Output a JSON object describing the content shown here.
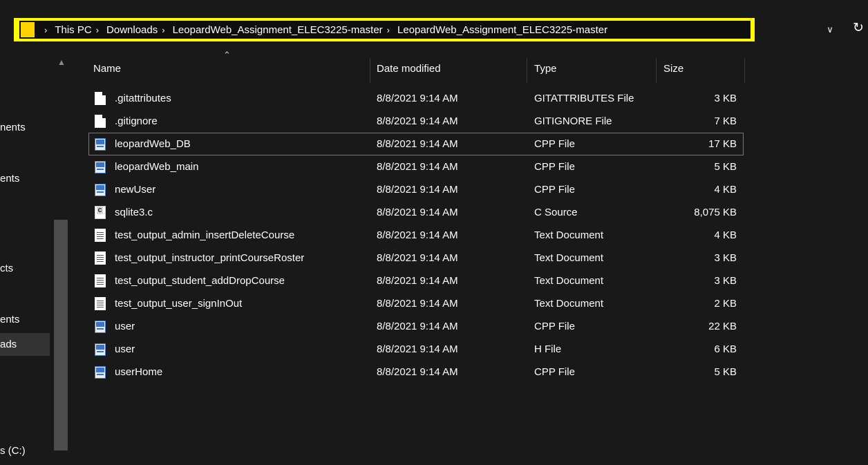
{
  "address_bar": {
    "breadcrumbs": [
      "This PC",
      "Downloads",
      "LeopardWeb_Assignment_ELEC3225-master",
      "LeopardWeb_Assignment_ELEC3225-master"
    ],
    "separator": "›",
    "highlight_color": "#fffb00",
    "folder_icon": "folder-icon",
    "dropdown_icon": "chevron-down-icon",
    "refresh_icon": "refresh-icon"
  },
  "nav_pane": {
    "items": [
      {
        "label": "nents"
      },
      {
        "label": "ents"
      },
      {
        "label": "cts"
      },
      {
        "label": "ents"
      },
      {
        "label": "ads",
        "selected": true
      },
      {
        "label": "s (C:)"
      }
    ]
  },
  "columns": {
    "name": "Name",
    "date": "Date modified",
    "type": "Type",
    "size": "Size"
  },
  "files": [
    {
      "name": ".gitattributes",
      "date": "8/8/2021 9:14 AM",
      "type": "GITATTRIBUTES File",
      "size": "3 KB",
      "icon": "generic-file-icon"
    },
    {
      "name": ".gitignore",
      "date": "8/8/2021 9:14 AM",
      "type": "GITIGNORE File",
      "size": "7 KB",
      "icon": "generic-file-icon"
    },
    {
      "name": "leopardWeb_DB",
      "date": "8/8/2021 9:14 AM",
      "type": "CPP File",
      "size": "17 KB",
      "icon": "cpp-file-icon",
      "selected": true
    },
    {
      "name": "leopardWeb_main",
      "date": "8/8/2021 9:14 AM",
      "type": "CPP File",
      "size": "5 KB",
      "icon": "cpp-file-icon"
    },
    {
      "name": "newUser",
      "date": "8/8/2021 9:14 AM",
      "type": "CPP File",
      "size": "4 KB",
      "icon": "cpp-file-icon"
    },
    {
      "name": "sqlite3.c",
      "date": "8/8/2021 9:14 AM",
      "type": "C Source",
      "size": "8,075 KB",
      "icon": "c-source-icon"
    },
    {
      "name": "test_output_admin_insertDeleteCourse",
      "date": "8/8/2021 9:14 AM",
      "type": "Text Document",
      "size": "4 KB",
      "icon": "text-document-icon"
    },
    {
      "name": "test_output_instructor_printCourseRoster",
      "date": "8/8/2021 9:14 AM",
      "type": "Text Document",
      "size": "3 KB",
      "icon": "text-document-icon"
    },
    {
      "name": "test_output_student_addDropCourse",
      "date": "8/8/2021 9:14 AM",
      "type": "Text Document",
      "size": "3 KB",
      "icon": "text-document-icon"
    },
    {
      "name": "test_output_user_signInOut",
      "date": "8/8/2021 9:14 AM",
      "type": "Text Document",
      "size": "2 KB",
      "icon": "text-document-icon"
    },
    {
      "name": "user",
      "date": "8/8/2021 9:14 AM",
      "type": "CPP File",
      "size": "22 KB",
      "icon": "cpp-file-icon"
    },
    {
      "name": "user",
      "date": "8/8/2021 9:14 AM",
      "type": "H File",
      "size": "6 KB",
      "icon": "cpp-file-icon"
    },
    {
      "name": "userHome",
      "date": "8/8/2021 9:14 AM",
      "type": "CPP File",
      "size": "5 KB",
      "icon": "cpp-file-icon"
    }
  ]
}
